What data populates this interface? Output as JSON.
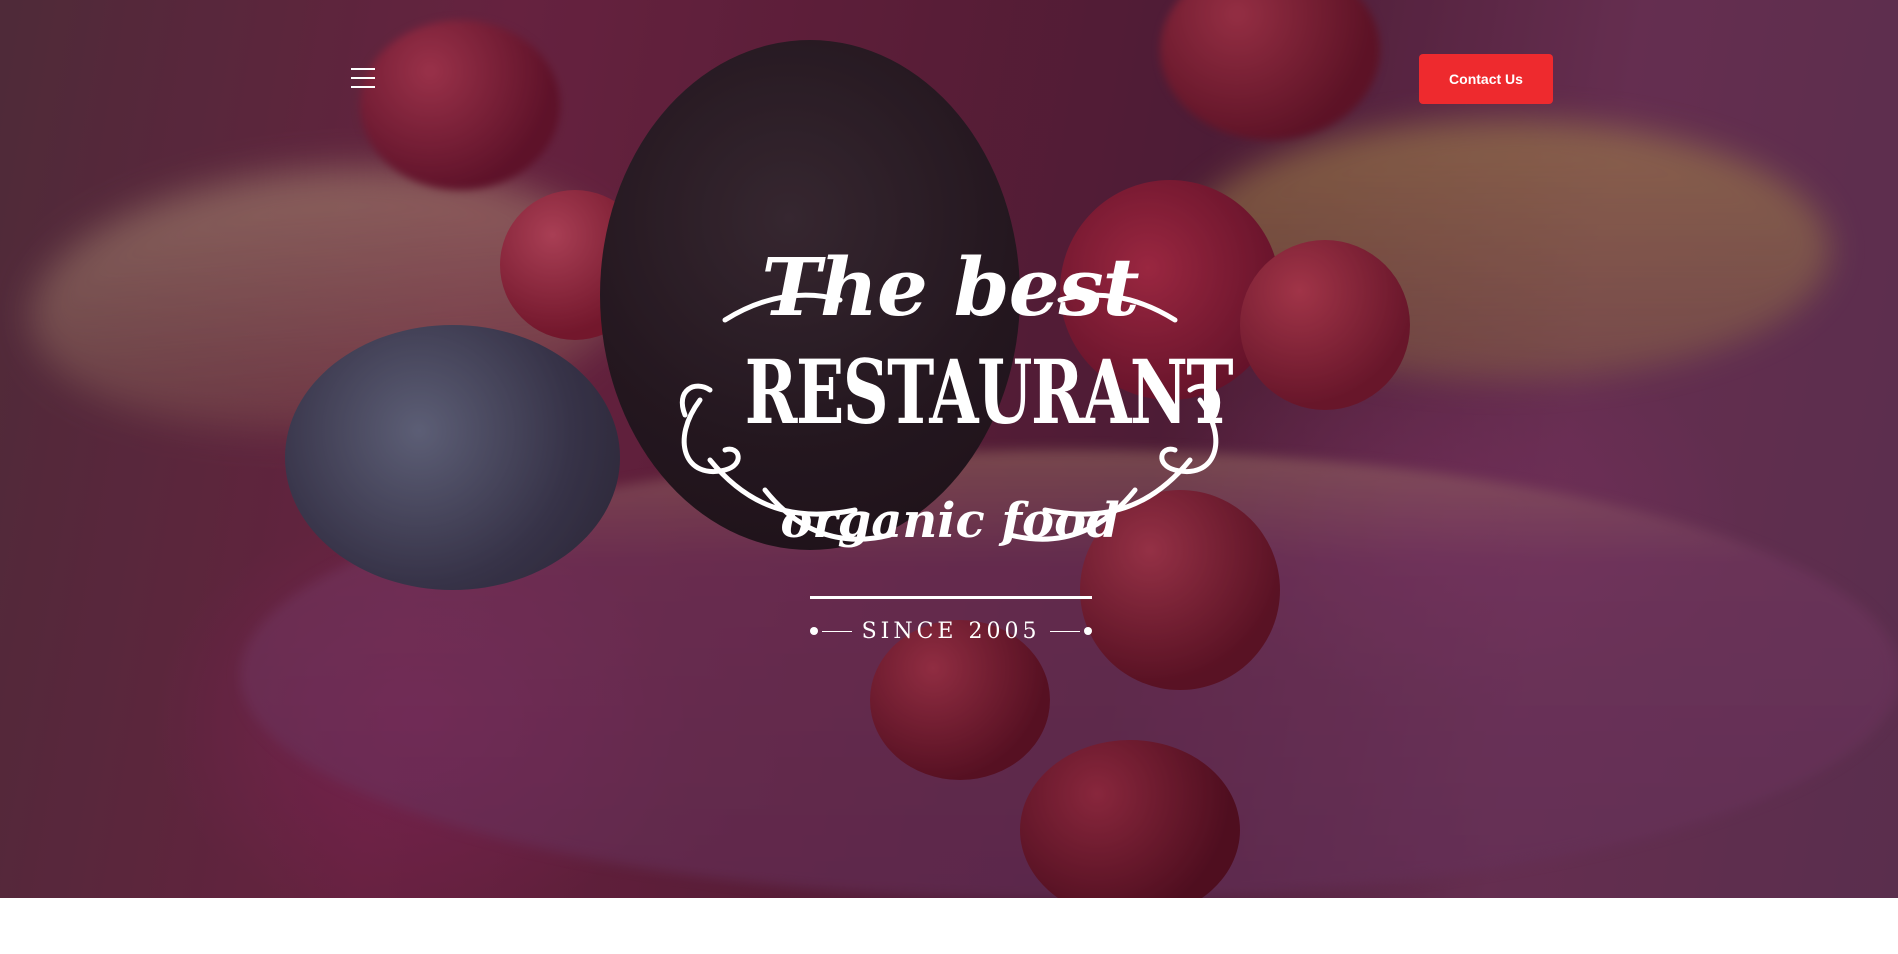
{
  "header": {
    "menu_icon": "hamburger-menu-icon",
    "contact_label": "Contact Us",
    "accent_color": "#ee2a2e"
  },
  "logo": {
    "line1": "The best",
    "line2": "RESTAURANT",
    "line3": "organic food",
    "since": "SINCE 2005"
  },
  "colors": {
    "button_text": "#ffffff",
    "logo_text": "#ffffff"
  }
}
